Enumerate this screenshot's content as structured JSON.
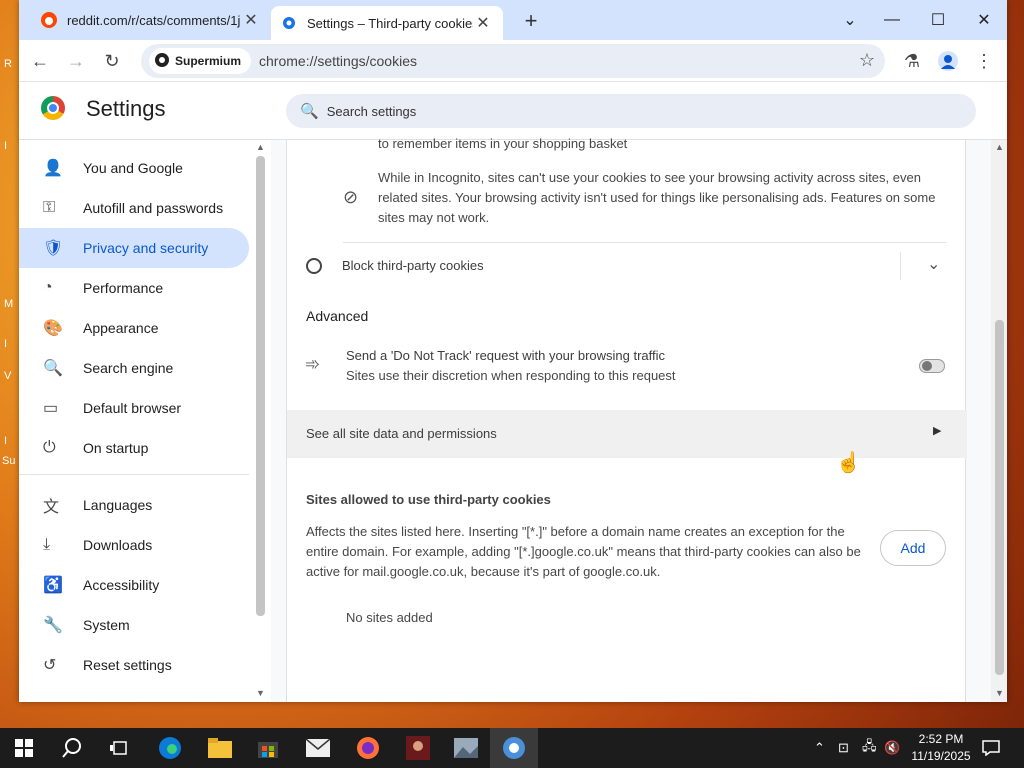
{
  "desktop": {
    "side_letters": [
      "R",
      "I",
      "M",
      "I",
      "V",
      "I",
      "Su"
    ]
  },
  "tabs": [
    {
      "title": "reddit.com/r/cats/comments/1j",
      "close": "✕"
    },
    {
      "title": "Settings – Third-party cookies",
      "close": "✕"
    }
  ],
  "new_tab": "+",
  "window_controls": {
    "dropdown": "⌄",
    "minimize": "—",
    "maximize": "☐",
    "close": "✕"
  },
  "toolbar": {
    "back": "←",
    "forward": "→",
    "reload": "↻",
    "site_chip": "Supermium",
    "url": "chrome://settings/cookies",
    "bookmark": "☆",
    "labs": "⚗",
    "menu": "⋮"
  },
  "settings": {
    "title": "Settings",
    "search_placeholder": "Search settings"
  },
  "sidebar": {
    "items": [
      {
        "label": "You and Google",
        "icon": "👤"
      },
      {
        "label": "Autofill and passwords",
        "icon": "⚿"
      },
      {
        "label": "Privacy and security",
        "icon": "🛡"
      },
      {
        "label": "Performance",
        "icon": "◔"
      },
      {
        "label": "Appearance",
        "icon": "🎨"
      },
      {
        "label": "Search engine",
        "icon": "🔍"
      },
      {
        "label": "Default browser",
        "icon": "▭"
      },
      {
        "label": "On startup",
        "icon": "⏻"
      },
      {
        "label": "Languages",
        "icon": "文"
      },
      {
        "label": "Downloads",
        "icon": "⤓"
      },
      {
        "label": "Accessibility",
        "icon": "♿"
      },
      {
        "label": "System",
        "icon": "🔧"
      },
      {
        "label": "Reset settings",
        "icon": "↺"
      }
    ]
  },
  "main": {
    "partial_line": "to remember items in your shopping basket",
    "incognito_text": "While in Incognito, sites can't use your cookies to see your browsing activity across sites, even related sites. Your browsing activity isn't used for things like personalising ads. Features on some sites may not work.",
    "block_label": "Block third-party cookies",
    "advanced_heading": "Advanced",
    "dnt_title": "Send a 'Do Not Track' request with your browsing traffic",
    "dnt_sub": "Sites use their discretion when responding to this request",
    "see_all": "See all site data and permissions",
    "allowed_heading": "Sites allowed to use third-party cookies",
    "allowed_desc": "Affects the sites listed here. Inserting \"[*.]\" before a domain name creates an exception for the entire domain. For example, adding \"[*.]google.co.uk\" means that third-party cookies can also be active for mail.google.co.uk, because it's part of google.co.uk.",
    "add_button": "Add",
    "no_sites": "No sites added"
  },
  "taskbar": {
    "clock_time": "2:52 PM",
    "clock_date": "11/19/2025"
  }
}
